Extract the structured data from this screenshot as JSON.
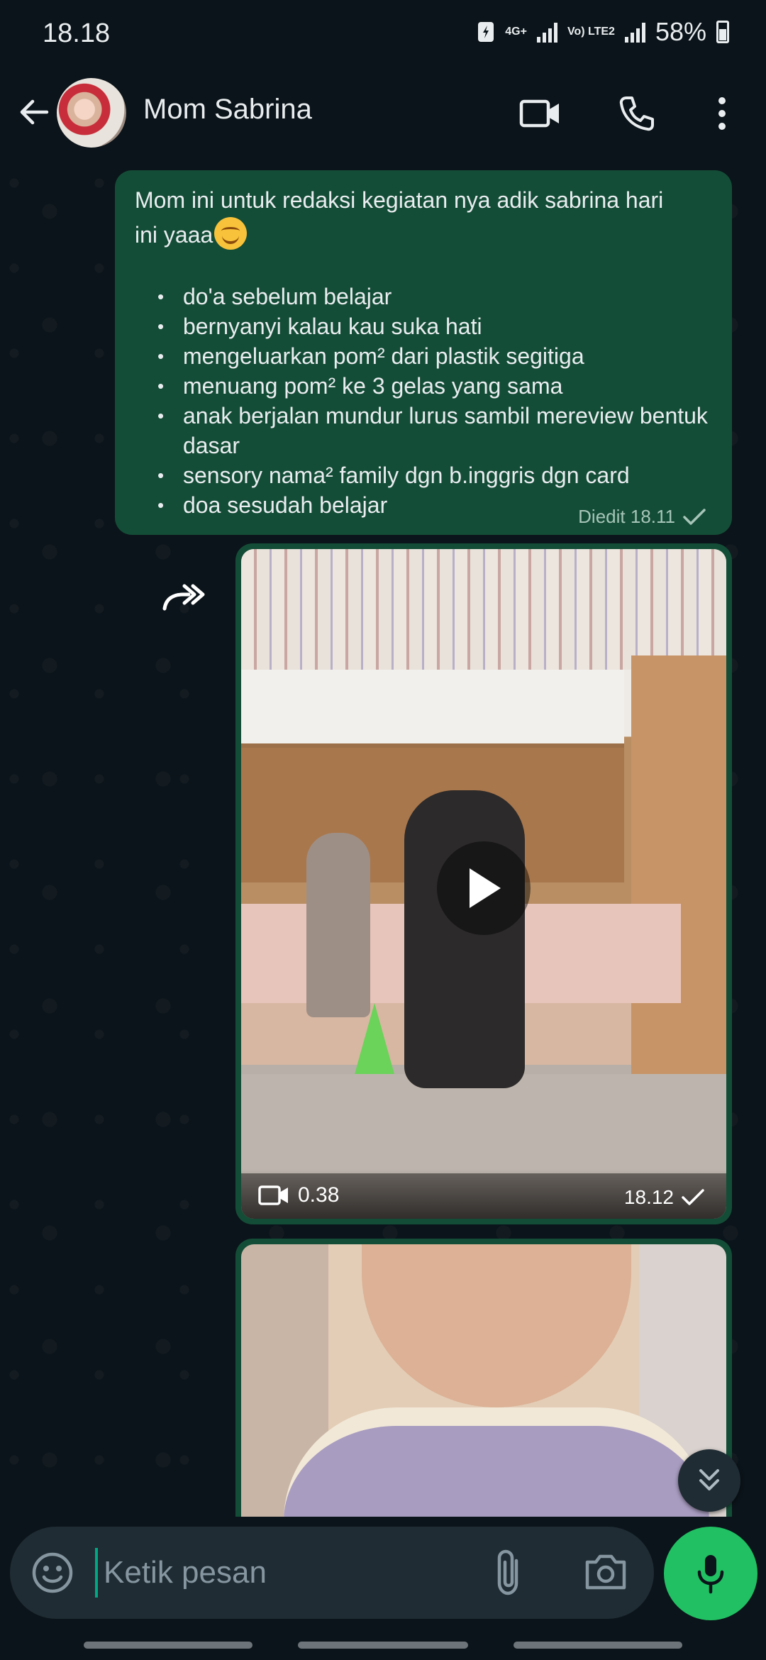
{
  "status_bar": {
    "time": "18.18",
    "network_1": "4G+",
    "network_2": "Vo) LTE2",
    "battery": "58%"
  },
  "header": {
    "contact_name": "Mom Sabrina"
  },
  "messages": {
    "text": {
      "intro": "Mom ini untuk redaksi kegiatan nya adik sabrina hari ini yaaa",
      "items": [
        "do'a sebelum belajar",
        "bernyanyi kalau kau suka hati",
        "mengeluarkan  pom² dari plastik segitiga",
        "menuang pom² ke 3 gelas yang sama",
        "anak berjalan mundur lurus sambil mereview bentuk dasar",
        "sensory nama² family dgn b.inggris  dgn card",
        "doa sesudah belajar"
      ],
      "meta": "Diedit 18.11"
    },
    "video": {
      "duration": "0.38",
      "time": "18.12"
    }
  },
  "composer": {
    "placeholder": "Ketik pesan"
  },
  "colors": {
    "background": "#0b141a",
    "outgoing_bubble": "#144d37",
    "accent_green": "#21c063",
    "input_bg": "#1f2c33"
  }
}
